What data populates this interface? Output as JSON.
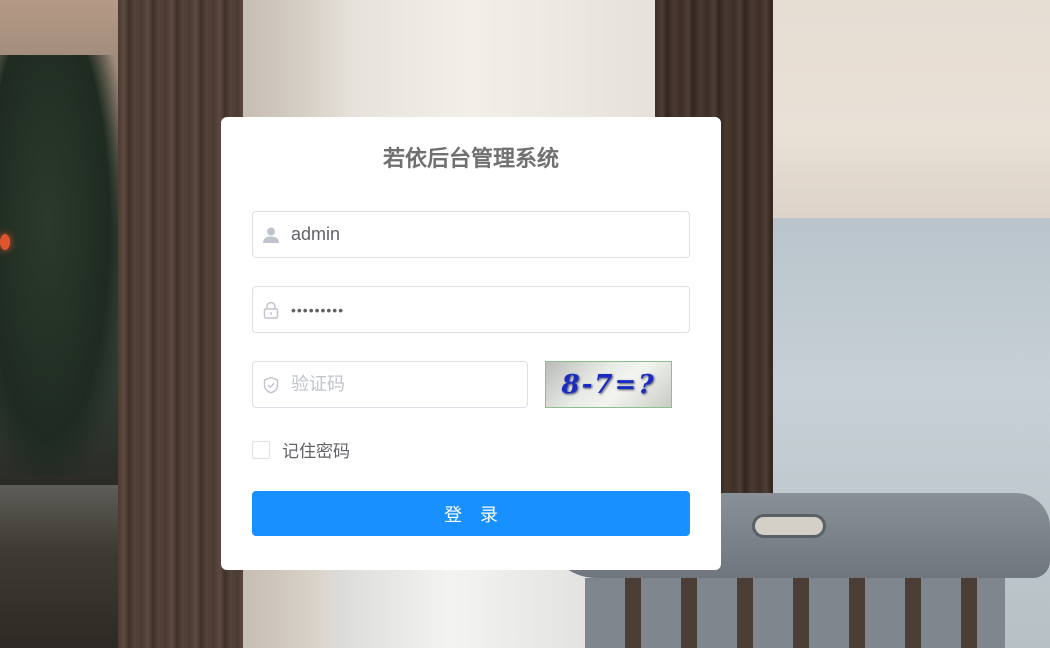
{
  "app": {
    "title": "若依后台管理系统"
  },
  "login_form": {
    "username": {
      "value": "admin",
      "icon": "user-icon"
    },
    "password": {
      "value": "•••••••••",
      "icon": "lock-icon"
    },
    "captcha_input": {
      "placeholder": "验证码",
      "value": "",
      "icon": "shield-check-icon"
    },
    "captcha_image": {
      "text": "8-7=?"
    },
    "remember": {
      "label": "记住密码",
      "checked": false
    },
    "submit_label": "登 录"
  },
  "colors": {
    "primary": "#1890ff",
    "title_text": "#707070",
    "border": "#dcdfe6",
    "placeholder": "#c0c4cc"
  }
}
